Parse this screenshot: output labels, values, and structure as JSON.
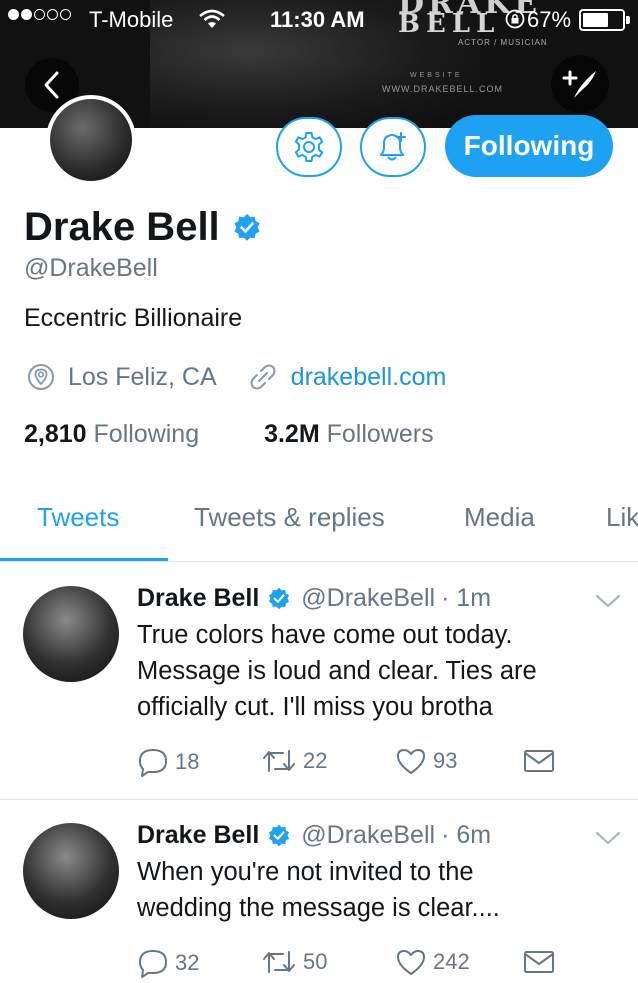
{
  "status_bar": {
    "signal_filled": 2,
    "signal_total": 5,
    "carrier": "T-Mobile",
    "time": "11:30 AM",
    "battery_percent": "67%",
    "battery_level": 0.67
  },
  "banner": {
    "logo_top": "DRAKE",
    "logo": "BELL",
    "subtitle": "ACTOR / MUSICIAN",
    "website_label": "WEBSITE",
    "website_url": "WWW.DRAKEBELL.COM"
  },
  "header": {
    "back_icon": "chevron-left-icon",
    "compose_icon": "compose-tweet-icon"
  },
  "profile": {
    "name": "Drake Bell",
    "verified": true,
    "handle": "@DrakeBell",
    "bio": "Eccentric Billionaire",
    "location": "Los Feliz, CA",
    "website": "drakebell.com",
    "following_count": "2,810",
    "following_label": "Following",
    "followers_count": "3.2M",
    "followers_label": "Followers",
    "follow_button": "Following"
  },
  "tabs": [
    {
      "label": "Tweets",
      "active": true
    },
    {
      "label": "Tweets & replies",
      "active": false
    },
    {
      "label": "Media",
      "active": false
    },
    {
      "label": "Lik",
      "active": false
    }
  ],
  "tweets": [
    {
      "name": "Drake Bell",
      "handle": "@DrakeBell",
      "time": "· 1m",
      "text_lines": [
        "True colors have come out today.",
        "Message is loud and clear. Ties are",
        "officially cut. I'll miss you brotha"
      ],
      "replies": "18",
      "retweets": "22",
      "likes": "93"
    },
    {
      "name": "Drake Bell",
      "handle": "@DrakeBell",
      "time": "· 6m",
      "text_lines": [
        "When you're not invited to the",
        "wedding the message is clear...."
      ],
      "replies": "32",
      "retweets": "50",
      "likes": "242"
    }
  ],
  "colors": {
    "accent": "#1da1f2",
    "link": "#1b95e0",
    "secondary_text": "#657786",
    "primary_text": "#14171a",
    "divider": "#e1e8ed"
  }
}
